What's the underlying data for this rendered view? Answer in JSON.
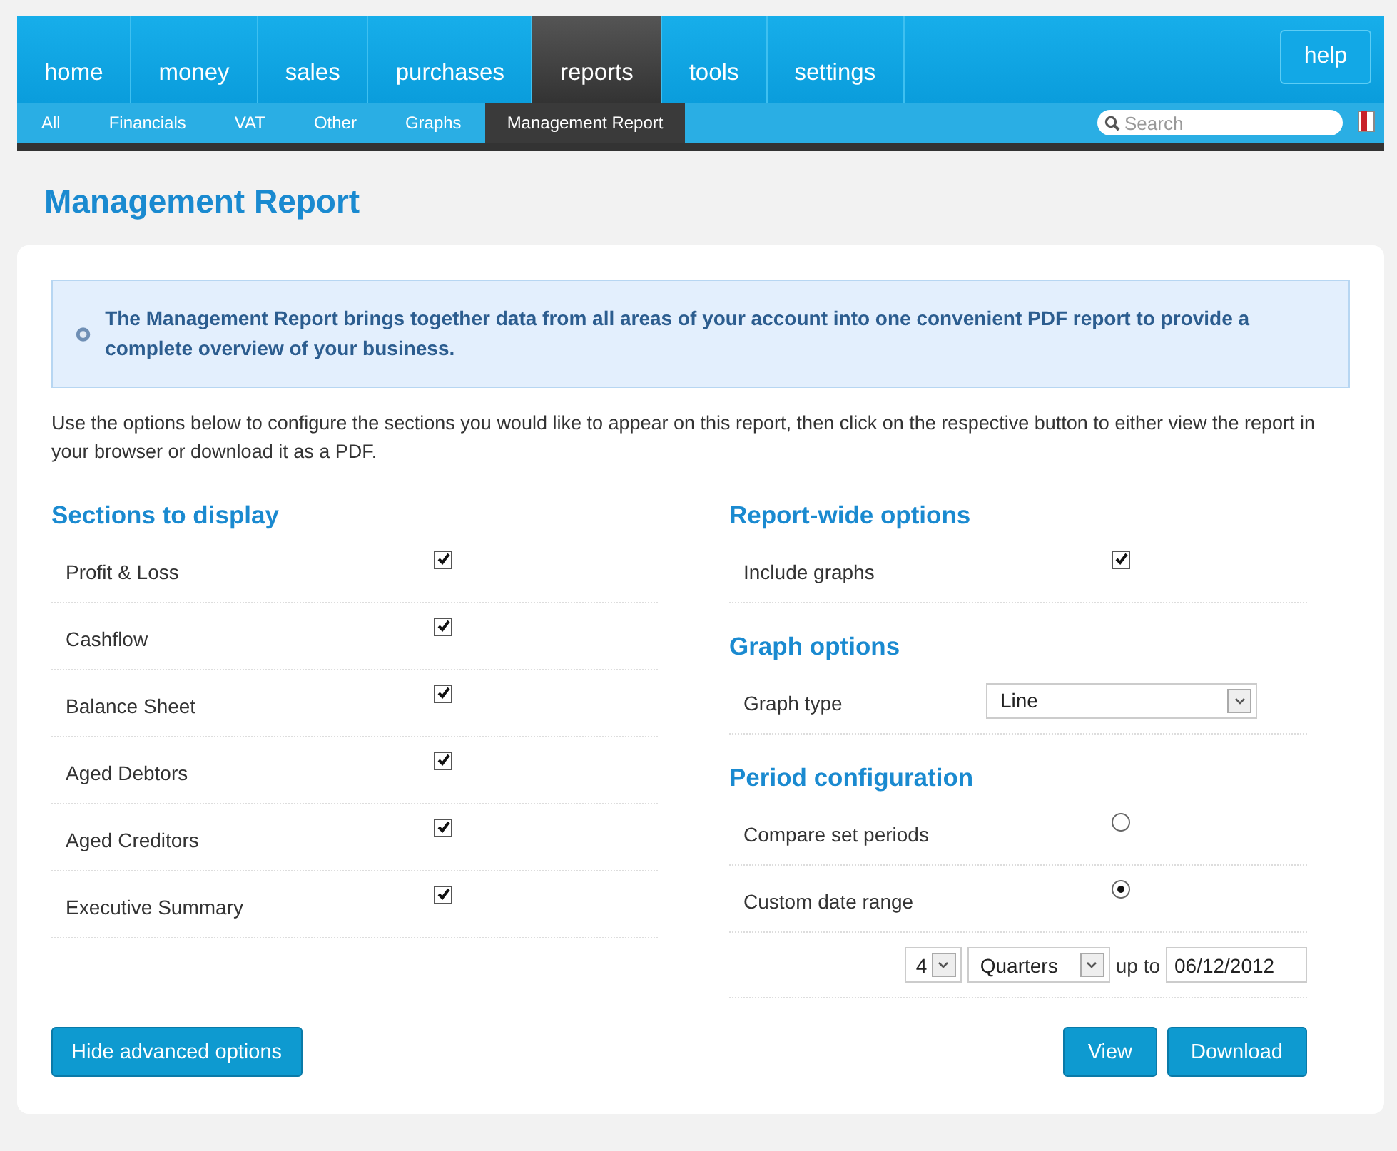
{
  "nav": {
    "tabs": [
      {
        "label": "home",
        "selected": false
      },
      {
        "label": "money",
        "selected": false
      },
      {
        "label": "sales",
        "selected": false
      },
      {
        "label": "purchases",
        "selected": false
      },
      {
        "label": "reports",
        "selected": true
      },
      {
        "label": "tools",
        "selected": false
      },
      {
        "label": "settings",
        "selected": false
      }
    ],
    "help": "help"
  },
  "subnav": {
    "tabs": [
      {
        "label": "All",
        "selected": false
      },
      {
        "label": "Financials",
        "selected": false
      },
      {
        "label": "VAT",
        "selected": false
      },
      {
        "label": "Other",
        "selected": false
      },
      {
        "label": "Graphs",
        "selected": false
      },
      {
        "label": "Management Report",
        "selected": true
      }
    ],
    "search": {
      "placeholder": "Search"
    }
  },
  "page_title": "Management Report",
  "info": "The Management Report brings together data from all areas of your account into one convenient PDF report to provide a complete overview of your business.",
  "intro": "Use the options below to configure the sections you would like to appear on this report, then click on the respective button to either view the report in your browser or download it as a PDF.",
  "sections_to_display": {
    "title": "Sections to display",
    "options": [
      {
        "label": "Profit & Loss",
        "checked": true
      },
      {
        "label": "Cashflow",
        "checked": true
      },
      {
        "label": "Balance Sheet",
        "checked": true
      },
      {
        "label": "Aged Debtors",
        "checked": true
      },
      {
        "label": "Aged Creditors",
        "checked": true
      },
      {
        "label": "Executive Summary",
        "checked": true
      }
    ]
  },
  "report_wide_options": {
    "title": "Report-wide options",
    "options": [
      {
        "label": "Include graphs",
        "checked": true
      }
    ]
  },
  "graph_options": {
    "title": "Graph options",
    "graph_type": {
      "label": "Graph type",
      "value": "Line"
    }
  },
  "period_configuration": {
    "title": "Period configuration",
    "options": [
      {
        "label": "Compare set periods",
        "selected": false
      },
      {
        "label": "Custom date range",
        "selected": true
      }
    ],
    "range": {
      "count": "4",
      "unit": "Quarters",
      "separator": "up to",
      "date": "06/12/2012"
    }
  },
  "buttons": {
    "hide_advanced": "Hide advanced options",
    "view": "View",
    "download": "Download"
  }
}
